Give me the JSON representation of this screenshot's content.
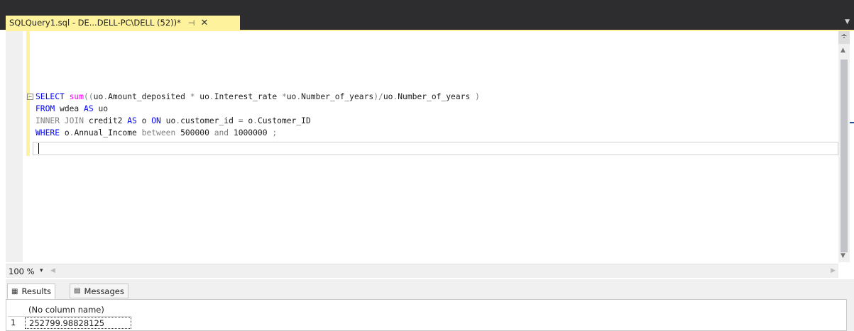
{
  "document_tab": {
    "title": "SQLQuery1.sql - DE...DELL-PC\\DELL (52))*",
    "pin_glyph": "⊣",
    "close_glyph": "✕"
  },
  "editor": {
    "lines": [
      {
        "tokens": [
          {
            "t": "kw",
            "v": "SELECT"
          },
          {
            "t": "tx",
            "v": " "
          },
          {
            "t": "fn",
            "v": "sum"
          },
          {
            "t": "op",
            "v": "(("
          },
          {
            "t": "tx",
            "v": "uo"
          },
          {
            "t": "op",
            "v": "."
          },
          {
            "t": "tx",
            "v": "Amount_deposited "
          },
          {
            "t": "op",
            "v": "*"
          },
          {
            "t": "tx",
            "v": " uo"
          },
          {
            "t": "op",
            "v": "."
          },
          {
            "t": "tx",
            "v": "Interest_rate "
          },
          {
            "t": "op",
            "v": "*"
          },
          {
            "t": "tx",
            "v": "uo"
          },
          {
            "t": "op",
            "v": "."
          },
          {
            "t": "tx",
            "v": "Number_of_years"
          },
          {
            "t": "op",
            "v": ")/"
          },
          {
            "t": "tx",
            "v": "uo"
          },
          {
            "t": "op",
            "v": "."
          },
          {
            "t": "tx",
            "v": "Number_of_years "
          },
          {
            "t": "op",
            "v": ")"
          }
        ]
      },
      {
        "tokens": [
          {
            "t": "kw",
            "v": "FROM"
          },
          {
            "t": "tx",
            "v": " wdea "
          },
          {
            "t": "kw",
            "v": "AS"
          },
          {
            "t": "tx",
            "v": " uo"
          }
        ]
      },
      {
        "tokens": [
          {
            "t": "op",
            "v": "INNER JOIN"
          },
          {
            "t": "tx",
            "v": " credit2 "
          },
          {
            "t": "kw",
            "v": "AS"
          },
          {
            "t": "tx",
            "v": " o "
          },
          {
            "t": "kw",
            "v": "ON"
          },
          {
            "t": "tx",
            "v": " uo"
          },
          {
            "t": "op",
            "v": "."
          },
          {
            "t": "tx",
            "v": "customer_id "
          },
          {
            "t": "op",
            "v": "="
          },
          {
            "t": "tx",
            "v": " o"
          },
          {
            "t": "op",
            "v": "."
          },
          {
            "t": "tx",
            "v": "Customer_ID"
          }
        ]
      },
      {
        "tokens": [
          {
            "t": "kw",
            "v": "WHERE"
          },
          {
            "t": "tx",
            "v": " o"
          },
          {
            "t": "op",
            "v": "."
          },
          {
            "t": "tx",
            "v": "Annual_Income "
          },
          {
            "t": "op",
            "v": "between"
          },
          {
            "t": "tx",
            "v": " 500000 "
          },
          {
            "t": "op",
            "v": "and"
          },
          {
            "t": "tx",
            "v": " 1000000 "
          },
          {
            "t": "op",
            "v": ";"
          }
        ]
      }
    ],
    "collapse_glyph": "−"
  },
  "zoom": {
    "value": "100 %",
    "dropdown_glyph": "▾"
  },
  "results": {
    "tabs": [
      {
        "label": "Results",
        "icon": "grid-icon"
      },
      {
        "label": "Messages",
        "icon": "messages-icon"
      }
    ],
    "columns": [
      "(No column name)"
    ],
    "rows": [
      {
        "num": "1",
        "values": [
          "252799.98828125"
        ]
      }
    ]
  },
  "colors": {
    "keyword": "#0000ff",
    "function": "#ff00ff",
    "operator": "#808080",
    "tab_highlight": "#fff29d",
    "chrome_dark": "#2d2d30"
  }
}
